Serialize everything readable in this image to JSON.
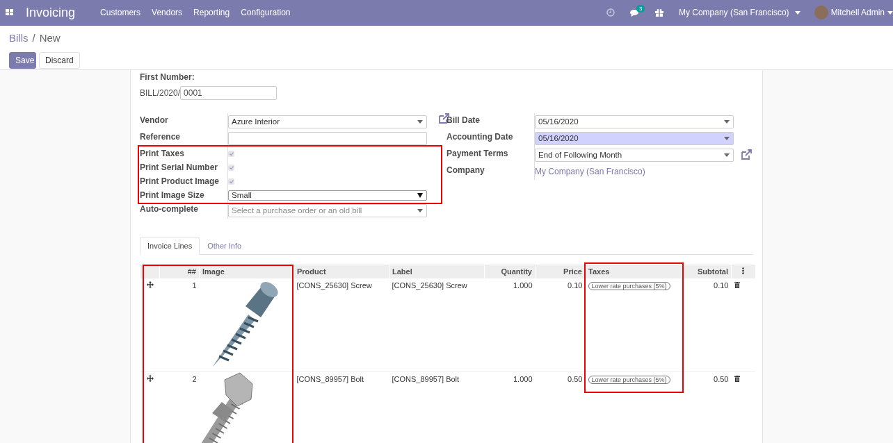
{
  "navbar": {
    "app_title": "Invoicing",
    "menu": [
      "Customers",
      "Vendors",
      "Reporting",
      "Configuration"
    ],
    "messages_badge": "3",
    "company": "My Company (San Francisco)",
    "user": "Mitchell Admin"
  },
  "breadcrumb": {
    "parent": "Bills",
    "separator": "/",
    "current": "New"
  },
  "buttons": [
    {
      "label": "Save",
      "kind": "primary"
    },
    {
      "label": "Discard",
      "kind": "secondary"
    }
  ],
  "sequence": {
    "label": "First Number:",
    "prefix": "BILL/2020/",
    "value": "0001"
  },
  "left_fields": [
    {
      "label": "Vendor",
      "kind": "select",
      "value": "Azure Interior",
      "external_link": true,
      "highlighted": false
    },
    {
      "label": "Reference",
      "kind": "text",
      "highlighted": false
    },
    {
      "label": "Print Taxes",
      "kind": "checkbox",
      "checked": true
    },
    {
      "label": "Print Serial Number",
      "kind": "checkbox",
      "checked": true
    },
    {
      "label": "Print Product Image",
      "kind": "checkbox",
      "checked": true
    },
    {
      "label": "Print Image Size",
      "kind": "native-select",
      "value": "Small",
      "highlighted": false
    },
    {
      "label": "Auto-complete",
      "kind": "select",
      "placeholder": "Select a purchase order or an old bill",
      "highlighted": false
    }
  ],
  "right_fields": [
    {
      "label": "Bill Date",
      "kind": "select",
      "value": "05/16/2020",
      "highlighted": false
    },
    {
      "label": "Accounting Date",
      "kind": "select",
      "value": "05/16/2020",
      "highlighted": true
    },
    {
      "label": "Payment Terms",
      "kind": "select",
      "value": "End of Following Month",
      "external_link": true,
      "highlighted": false
    },
    {
      "label": "Company",
      "kind": "link",
      "value": "My Company (San Francisco)"
    }
  ],
  "tabs": [
    {
      "label": "Invoice Lines",
      "selected": true
    },
    {
      "label": "Other Info",
      "selected": false
    }
  ],
  "lines": {
    "columns": [
      "##",
      "Image",
      "Product",
      "Label",
      "Quantity",
      "Price",
      "Taxes",
      "Subtotal"
    ],
    "rows": [
      {
        "number": "1",
        "kind": "screw",
        "product": "[CONS_25630] Screw",
        "label": "[CONS_25630] Screw",
        "quantity": "1.000",
        "price": "0.10",
        "tax": "Lower rate purchases (5%)",
        "subtotal": "0.10"
      },
      {
        "number": "2",
        "kind": "bolt",
        "product": "[CONS_89957] Bolt",
        "label": "[CONS_89957] Bolt",
        "quantity": "1.000",
        "price": "0.50",
        "tax": "Lower rate purchases (5%)",
        "subtotal": "0.50"
      }
    ]
  }
}
